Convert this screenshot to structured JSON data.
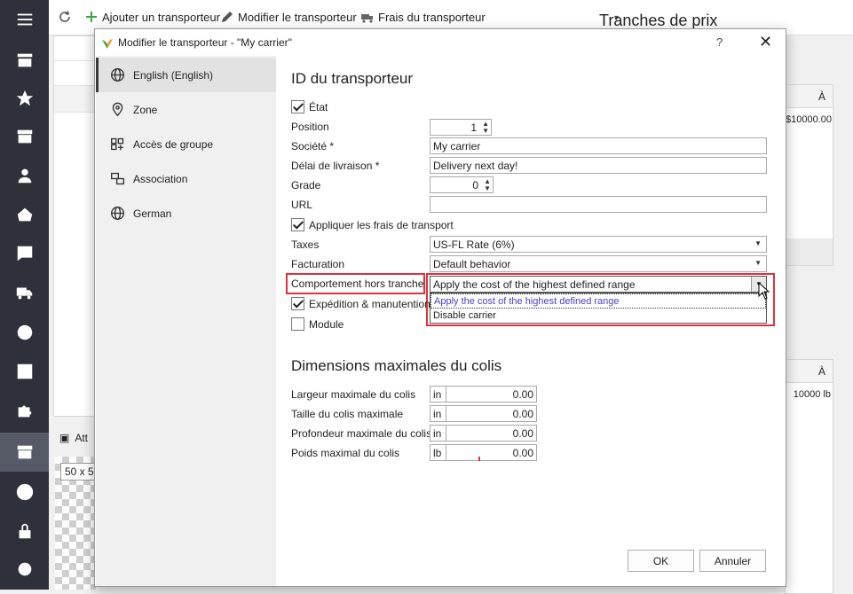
{
  "toolbar": {
    "add_carrier": "Ajouter un transporteur",
    "edit_carrier": "Modifier le transporteur",
    "carrier_fees": "Frais du transporteur",
    "tranches_title": "Tranches de prix"
  },
  "background": {
    "col_a": "À",
    "price_value": "$10000.00",
    "col_b": "À",
    "weight_value": "10000 lb",
    "attach_label": "Att",
    "size_label": "50 x 5"
  },
  "dialog": {
    "title": "Modifier le transporteur - \"My carrier\"",
    "help": "?",
    "close": "✕",
    "sidebar": [
      {
        "label": "English (English)",
        "icon": "globe-icon"
      },
      {
        "label": "Zone",
        "icon": "map-pin-icon"
      },
      {
        "label": "Accès de groupe",
        "icon": "group-add-icon"
      },
      {
        "label": "Association",
        "icon": "association-icon"
      },
      {
        "label": "German",
        "icon": "globe-icon"
      }
    ],
    "section1_title": "ID du transporteur",
    "etat_label": "État",
    "position_label": "Position",
    "position_value": "1",
    "societe_label": "Société *",
    "societe_value": "My carrier",
    "delai_label": "Délai de livraison *",
    "delai_value": "Delivery next day!",
    "grade_label": "Grade",
    "grade_value": "0",
    "url_label": "URL",
    "url_value": "",
    "appliquer_label": "Appliquer les frais de transport",
    "taxes_label": "Taxes",
    "taxes_value": "US-FL Rate (6%)",
    "facturation_label": "Facturation",
    "facturation_value": "Default behavior",
    "comportement_label": "Comportement hors tranche",
    "comportement_value": "Apply the cost of the highest defined range",
    "comportement_options": [
      "Apply the cost of the highest defined range",
      "Disable carrier"
    ],
    "expedition_label": "Expédition & manutention",
    "module_label": "Module",
    "section2_title": "Dimensions maximales du colis",
    "dims": [
      {
        "label": "Largeur maximale du colis",
        "unit": "in",
        "value": "0.00"
      },
      {
        "label": "Taille du colis maximale",
        "unit": "in",
        "value": "0.00"
      },
      {
        "label": "Profondeur maximale du colis",
        "unit": "in",
        "value": "0.00"
      },
      {
        "label": "Poids maximal du colis",
        "unit": "lb",
        "value": "0.00"
      }
    ],
    "ok_label": "OK",
    "cancel_label": "Annuler"
  },
  "colors": {
    "nav_bg": "#2e3139",
    "highlight_red": "#e0313e",
    "selected_option": "#4a3ec9",
    "add_icon_green": "#3aa63f"
  }
}
